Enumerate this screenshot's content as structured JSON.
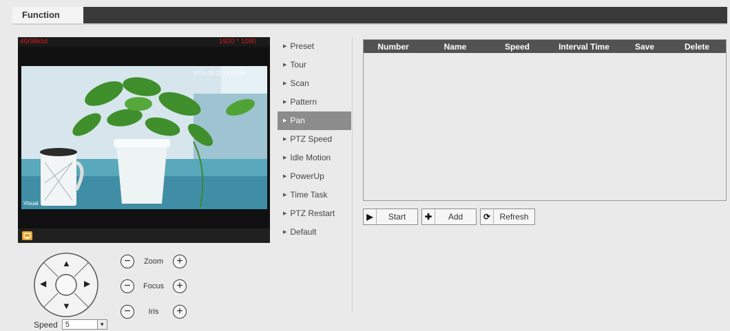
{
  "header": {
    "tab_label": "Function"
  },
  "video": {
    "fps": "40/98kbit",
    "resolution": "1920 * 1080",
    "osd_text": "2016-08-22 14:22:56",
    "channel_label": "Visual",
    "snapshot_icon": "snapshot-icon",
    "snapshot_color": "#e9a125"
  },
  "ptz": {
    "zoom_label": "Zoom",
    "focus_label": "Focus",
    "iris_label": "Iris",
    "minus_glyph": "−",
    "plus_glyph": "+",
    "speed_label": "Speed",
    "speed_value": "5",
    "dropdown_glyph": "▼",
    "dpad": {
      "up": "▲",
      "down": "▼",
      "left": "◀",
      "right": "▶"
    }
  },
  "menu": {
    "bullet": "▶",
    "items": [
      {
        "label": "Preset",
        "active": false
      },
      {
        "label": "Tour",
        "active": false
      },
      {
        "label": "Scan",
        "active": false
      },
      {
        "label": "Pattern",
        "active": false
      },
      {
        "label": "Pan",
        "active": true
      },
      {
        "label": "PTZ Speed",
        "active": false
      },
      {
        "label": "Idle Motion",
        "active": false
      },
      {
        "label": "PowerUp",
        "active": false
      },
      {
        "label": "Time Task",
        "active": false
      },
      {
        "label": "PTZ Restart",
        "active": false
      },
      {
        "label": "Default",
        "active": false
      }
    ]
  },
  "table": {
    "columns": [
      "Number",
      "Name",
      "Speed",
      "Interval Time",
      "Save",
      "Delete"
    ],
    "rows": []
  },
  "actions": {
    "start_label": "Start",
    "start_icon": "▶",
    "add_label": "Add",
    "add_icon": "✚",
    "refresh_label": "Refresh",
    "refresh_icon": "⟳"
  },
  "colors": {
    "active_menu": "#8c8c8c",
    "header_bar": "#3a3a3a",
    "table_header": "#525252"
  }
}
